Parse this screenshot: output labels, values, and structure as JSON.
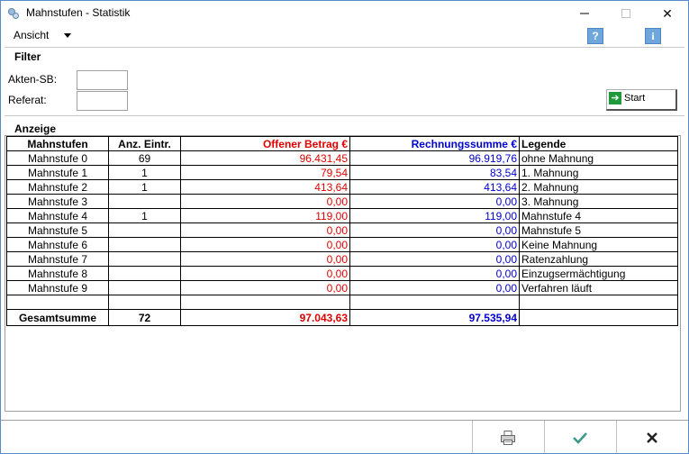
{
  "window": {
    "title": "Mahnstufen - Statistik",
    "minimize_icon": "minimize-icon",
    "maximize_icon": "maximize-icon",
    "close_glyph": "✕"
  },
  "menu": {
    "ansicht": "Ansicht",
    "help_glyph": "?",
    "info_glyph": "i"
  },
  "filter": {
    "title": "Filter",
    "akten_sb_label": "Akten-SB:",
    "akten_sb_value": "",
    "referat_label": "Referat:",
    "referat_value": "",
    "start_label": "Start"
  },
  "anzeige": {
    "title": "Anzeige",
    "headers": {
      "mahnstufen": "Mahnstufen",
      "anz": "Anz. Eintr.",
      "offen": "Offener Betrag €",
      "rechnung": "Rechnungssumme €",
      "legende": "Legende"
    },
    "rows": [
      {
        "name": "Mahnstufe 0",
        "anz": "69",
        "offen": "96.431,45",
        "rechnung": "96.919,76",
        "legende": "ohne Mahnung"
      },
      {
        "name": "Mahnstufe 1",
        "anz": "1",
        "offen": "79,54",
        "rechnung": "83,54",
        "legende": "1. Mahnung"
      },
      {
        "name": "Mahnstufe 2",
        "anz": "1",
        "offen": "413,64",
        "rechnung": "413,64",
        "legende": "2. Mahnung"
      },
      {
        "name": "Mahnstufe 3",
        "anz": "",
        "offen": "0,00",
        "rechnung": "0,00",
        "legende": "3. Mahnung"
      },
      {
        "name": "Mahnstufe 4",
        "anz": "1",
        "offen": "119,00",
        "rechnung": "119,00",
        "legende": "Mahnstufe 4"
      },
      {
        "name": "Mahnstufe 5",
        "anz": "",
        "offen": "0,00",
        "rechnung": "0,00",
        "legende": "Mahnstufe 5"
      },
      {
        "name": "Mahnstufe 6",
        "anz": "",
        "offen": "0,00",
        "rechnung": "0,00",
        "legende": "Keine Mahnung"
      },
      {
        "name": "Mahnstufe 7",
        "anz": "",
        "offen": "0,00",
        "rechnung": "0,00",
        "legende": "Ratenzahlung"
      },
      {
        "name": "Mahnstufe 8",
        "anz": "",
        "offen": "0,00",
        "rechnung": "0,00",
        "legende": "Einzugsermächtigung"
      },
      {
        "name": "Mahnstufe 9",
        "anz": "",
        "offen": "0,00",
        "rechnung": "0,00",
        "legende": "Verfahren läuft"
      }
    ],
    "sum": {
      "label": "Gesamtsumme",
      "anz": "72",
      "offen": "97.043,63",
      "rechnung": "97.535,94",
      "legende": ""
    }
  },
  "footer": {
    "print_icon": "printer-icon",
    "ok_icon": "checkmark-icon",
    "cancel_icon": "cancel-x-icon"
  },
  "colors": {
    "offen": "#e00000",
    "rechnung": "#0000d0",
    "start_icon": "#1e9a3a",
    "help_icon": "#6fa6dc",
    "ok_check": "#3a9a8a"
  }
}
